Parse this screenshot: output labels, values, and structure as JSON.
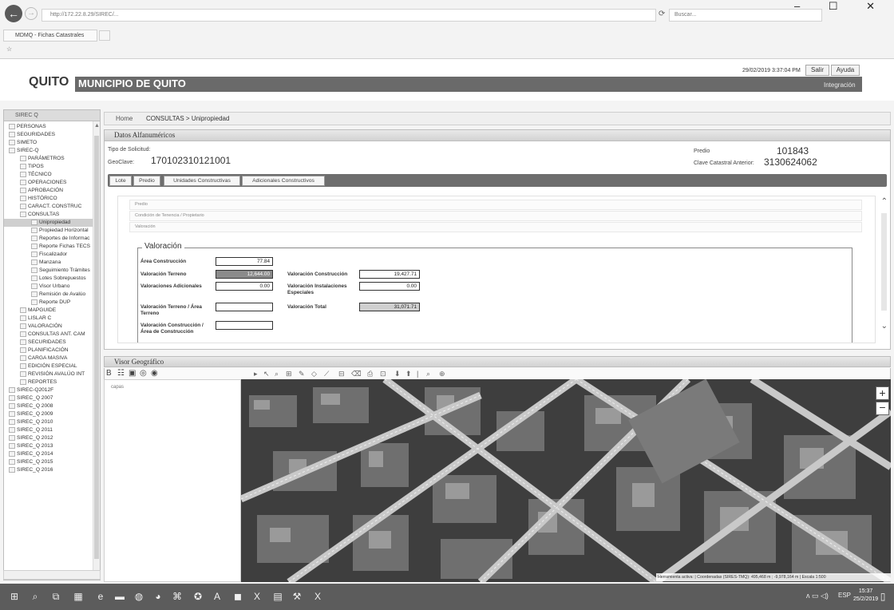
{
  "browser": {
    "address": "http://172.22.8.29/SIREC/...",
    "search_placeholder": "Buscar...",
    "tab_title": "MDMQ - Fichas Catastrales",
    "window_controls": "–  ☐  ✕"
  },
  "header": {
    "datetime": "29/02/2019  3:37:04 PM",
    "salir_label": "Salir",
    "ayuda_label": "Ayuda",
    "logo_quito": "QUITO",
    "logo_municipio": "MUNICIPIO DE QUITO",
    "user_name": "Integración"
  },
  "sidebar": {
    "title": "SIREC Q",
    "items": [
      {
        "label": "PERSONAS",
        "level": 1
      },
      {
        "label": "SEGURIDADES",
        "level": 1
      },
      {
        "label": "SIMETO",
        "level": 1
      },
      {
        "label": "SIREC-Q",
        "level": 1
      },
      {
        "label": "PARÁMETROS",
        "level": 2
      },
      {
        "label": "TIPOS",
        "level": 2
      },
      {
        "label": "TÉCNICO",
        "level": 2
      },
      {
        "label": "OPERACIONES",
        "level": 2
      },
      {
        "label": "APROBACIÓN",
        "level": 2
      },
      {
        "label": "HISTÓRICO",
        "level": 2
      },
      {
        "label": "CARACT. CONSTRUC",
        "level": 2
      },
      {
        "label": "CONSULTAS",
        "level": 2
      },
      {
        "label": "Unipropiedad",
        "level": 3
      },
      {
        "label": "Propiedad Horizontal",
        "level": 3
      },
      {
        "label": "Reportes de Informac",
        "level": 3
      },
      {
        "label": "Reporte Fichas TECS",
        "level": 3
      },
      {
        "label": "Fiscalizador",
        "level": 3
      },
      {
        "label": "Manzana",
        "level": 3
      },
      {
        "label": "Seguimiento Trámites",
        "level": 3
      },
      {
        "label": "Lotes Sobrepuestos",
        "level": 3
      },
      {
        "label": "Visor Urbano",
        "level": 3
      },
      {
        "label": "Remisión de Avalúo",
        "level": 3
      },
      {
        "label": "Reporte DUP",
        "level": 3
      },
      {
        "label": "MAPGUIDE",
        "level": 2
      },
      {
        "label": "LISLAR C",
        "level": 2
      },
      {
        "label": "VALORACIÓN",
        "level": 2
      },
      {
        "label": "CONSULTAS ANT. CAM",
        "level": 2
      },
      {
        "label": "SECURIDADES",
        "level": 2
      },
      {
        "label": "PLANIFICACIÓN",
        "level": 2
      },
      {
        "label": "CARGA MASIVA",
        "level": 2
      },
      {
        "label": "EDICIÓN ESPECIAL",
        "level": 2
      },
      {
        "label": "REVISIÓN AVALÚO INT",
        "level": 2
      },
      {
        "label": "REPORTES",
        "level": 2
      },
      {
        "label": "SIREC-Q2012F",
        "level": 1
      },
      {
        "label": "SIREC_Q 2007",
        "level": 1
      },
      {
        "label": "SIREC_Q 2008",
        "level": 1
      },
      {
        "label": "SIREC_Q 2009",
        "level": 1
      },
      {
        "label": "SIREC_Q 2010",
        "level": 1
      },
      {
        "label": "SIREC_Q 2011",
        "level": 1
      },
      {
        "label": "SIREC_Q 2012",
        "level": 1
      },
      {
        "label": "SIREC_Q 2013",
        "level": 1
      },
      {
        "label": "SIREC_Q 2014",
        "level": 1
      },
      {
        "label": "SIREC_Q 2015",
        "level": 1
      },
      {
        "label": "SIREC_Q 2016",
        "level": 1
      }
    ]
  },
  "breadcrumb": {
    "home": "Home",
    "path": "CONSULTAS  > Unipropiedad"
  },
  "datos": {
    "title": "Datos Alfanuméricos",
    "tipo_solicitud_label": "Tipo de Solicitud:",
    "geoclave_label": "GeoClave:",
    "geoclave_value": "170102310121001",
    "predio_label": "Predio",
    "predio_value": "101843",
    "clave_label": "Clave Catastral Anterior:",
    "clave_value": "3130624062",
    "tabs": [
      "Lote",
      "Predio",
      "Unidades Constructivas",
      "Adicionales Constructivos"
    ],
    "acc_predio": "Predio",
    "acc_condicion": "Condición de Tenencia / Propietario",
    "acc_valoracion": "Valoración"
  },
  "valoracion": {
    "legend": "Valoración",
    "area_construccion_label": "Área Construcción",
    "area_construccion_value": "77.84",
    "valoracion_terreno_label": "Valoración Terreno",
    "valoracion_terreno_value": "12,644.00",
    "valoraciones_adicionales_label": "Valoraciones Adicionales",
    "valoraciones_adicionales_value": "0.00",
    "valoracion_construccion_label": "Valoración Construcción",
    "valoracion_construccion_value": "19,427.71",
    "valoracion_instalaciones_label": "Valoración Instalaciones Especiales",
    "valoracion_instalaciones_value": "0.00",
    "valoracion_terreno_area_label": "Valoración Terreno / Área Terreno",
    "valoracion_total_label": "Valoración Total",
    "valoracion_total_value": "31,071.71",
    "valoracion_construccion_area_label": "Valoración Construcción / Área de Construcción"
  },
  "visor": {
    "title": "Visor Geográfico",
    "capas_label": "capas",
    "status_text": "Herramienta activa:  |  Coordenadas (SIRES-TMQ): 495,468 m ; -9,978,164 m  |  Escala 1:500"
  },
  "taskbar": {
    "time": "15:37",
    "date": "25/2/2019",
    "lang": "ESP"
  }
}
